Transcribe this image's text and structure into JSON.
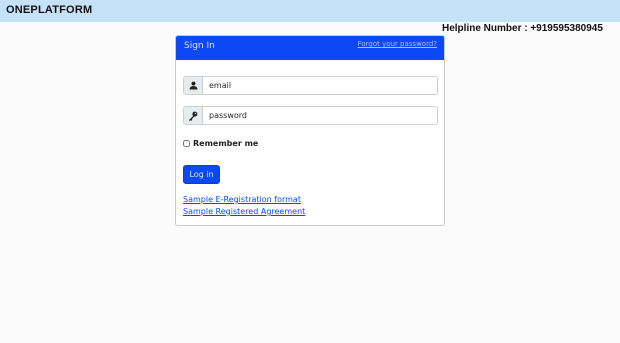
{
  "header": {
    "brand": "ONEPLATFORM"
  },
  "helpline": {
    "text": "Helpline Number : +919595380945"
  },
  "signin_card": {
    "title": "Sign In",
    "forgot_link": "Forgot your password?",
    "email": {
      "placeholder": "email",
      "icon": "user-icon"
    },
    "password": {
      "placeholder": "password",
      "icon": "key-icon"
    },
    "remember_label": "Remember me",
    "remember_checked": false,
    "login_button": "Log in",
    "links": [
      {
        "label": "Sample E-Registration format"
      },
      {
        "label": "Sample Registered Agreement"
      }
    ]
  },
  "colors": {
    "topbar": "#c6e2f8",
    "primary": "#0d48f5",
    "link": "#0d48f5"
  }
}
